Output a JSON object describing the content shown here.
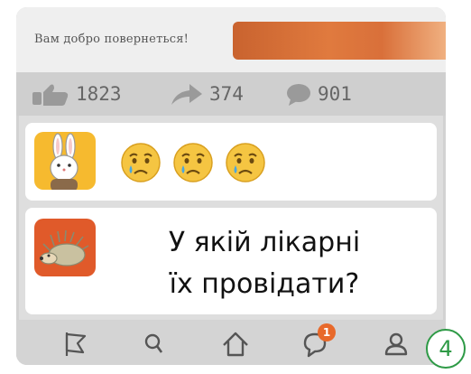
{
  "header": {
    "greeting": "Вам добро повернеться!"
  },
  "stats": {
    "likes": "1823",
    "shares": "374",
    "comments": "901"
  },
  "posts": [
    {
      "author": "rabbit",
      "reactions": [
        "crying-face-emoji",
        "crying-face-emoji",
        "crying-face-emoji"
      ]
    },
    {
      "author": "hedgehog",
      "text_line1": "У якій лікарні",
      "text_line2": "їх провідати?"
    }
  ],
  "nav": {
    "items": [
      "flag-icon",
      "search-icon",
      "home-icon",
      "messages-icon",
      "profile-icon"
    ],
    "messages_badge": "1"
  },
  "step_number": "4",
  "colors": {
    "accent_orange": "#e8692a",
    "step_green": "#2e9a46",
    "emoji_yellow": "#f5c542"
  }
}
